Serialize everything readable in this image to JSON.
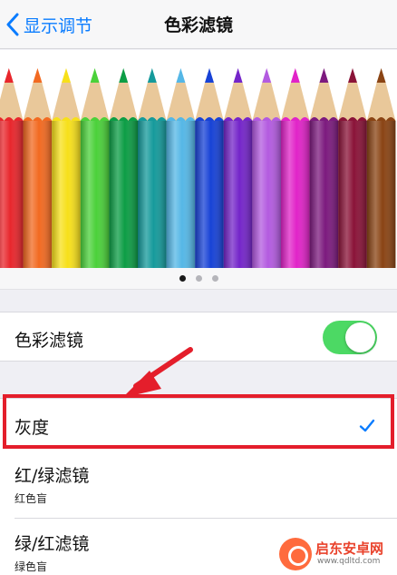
{
  "navbar": {
    "back_label": "显示调节",
    "title": "色彩滤镜"
  },
  "pencils": {
    "colors": [
      "#e8262c",
      "#f26a21",
      "#f7e01a",
      "#4bd13a",
      "#0c9d45",
      "#159a9b",
      "#55b7e6",
      "#1742d6",
      "#7425c9",
      "#b35be0",
      "#e123c8",
      "#7c1a7e",
      "#8a1338",
      "#8a4414"
    ]
  },
  "pager": {
    "page_count": 3,
    "current_page": 1
  },
  "settings": {
    "filter_toggle": {
      "label": "色彩滤镜",
      "on": true,
      "accent_color": "#4cd964"
    },
    "options": [
      {
        "label": "灰度",
        "subtitle": "",
        "selected": true
      },
      {
        "label": "红/绿滤镜",
        "subtitle": "红色盲",
        "selected": false
      },
      {
        "label": "绿/红滤镜",
        "subtitle": "绿色盲",
        "selected": false
      }
    ]
  },
  "annotation": {
    "color": "#e41e2b"
  },
  "watermark": {
    "brand": "启东安卓网",
    "url": "www.qdltd.com"
  }
}
